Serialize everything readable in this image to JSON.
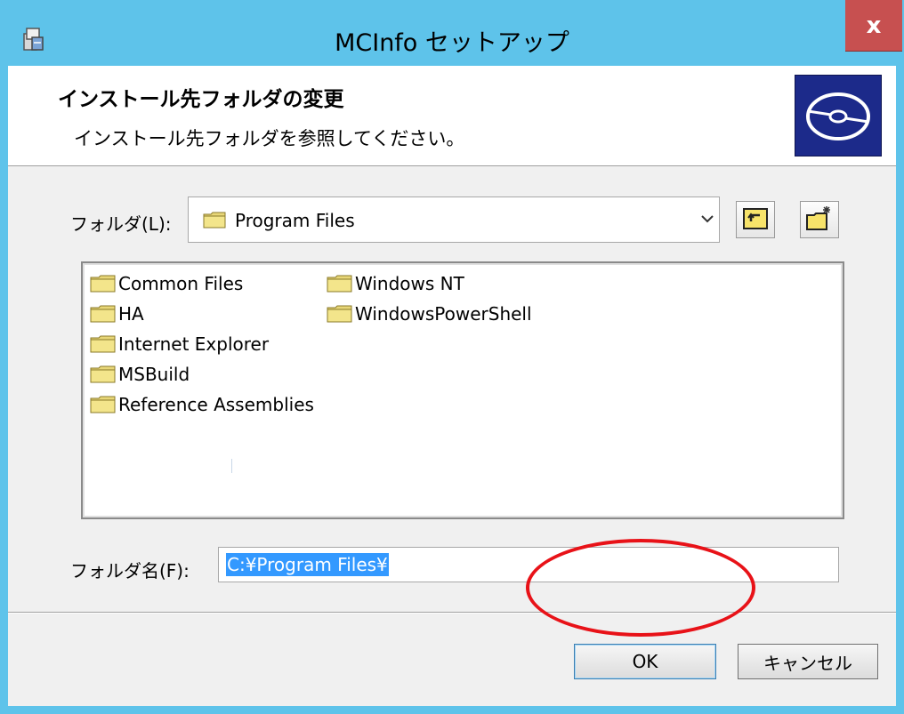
{
  "window": {
    "title": "MCInfo セットアップ",
    "close_label": "x"
  },
  "header": {
    "title": "インストール先フォルダの変更",
    "subtitle": "インストール先フォルダを参照してください。",
    "logo_icon": "install-disc-icon"
  },
  "folder_selector": {
    "label": "フォルダ(L):",
    "value": "Program Files",
    "dropdown_icon": "chevron-down-icon",
    "up_button_icon": "folder-up-icon",
    "new_folder_icon": "new-folder-icon"
  },
  "folder_list": {
    "items": [
      "Common Files",
      "HA",
      "Internet Explorer",
      "MSBuild",
      "Reference Assemblies",
      "Windows NT",
      "WindowsPowerShell"
    ]
  },
  "folder_name": {
    "label": "フォルダ名(F):",
    "value": "C:¥Program Files¥"
  },
  "buttons": {
    "ok": "OK",
    "cancel": "キャンセル"
  },
  "colors": {
    "title_bar": "#5ec3ea",
    "close_button": "#c75050",
    "selection": "#3399ff",
    "annotation": "#e81218"
  }
}
